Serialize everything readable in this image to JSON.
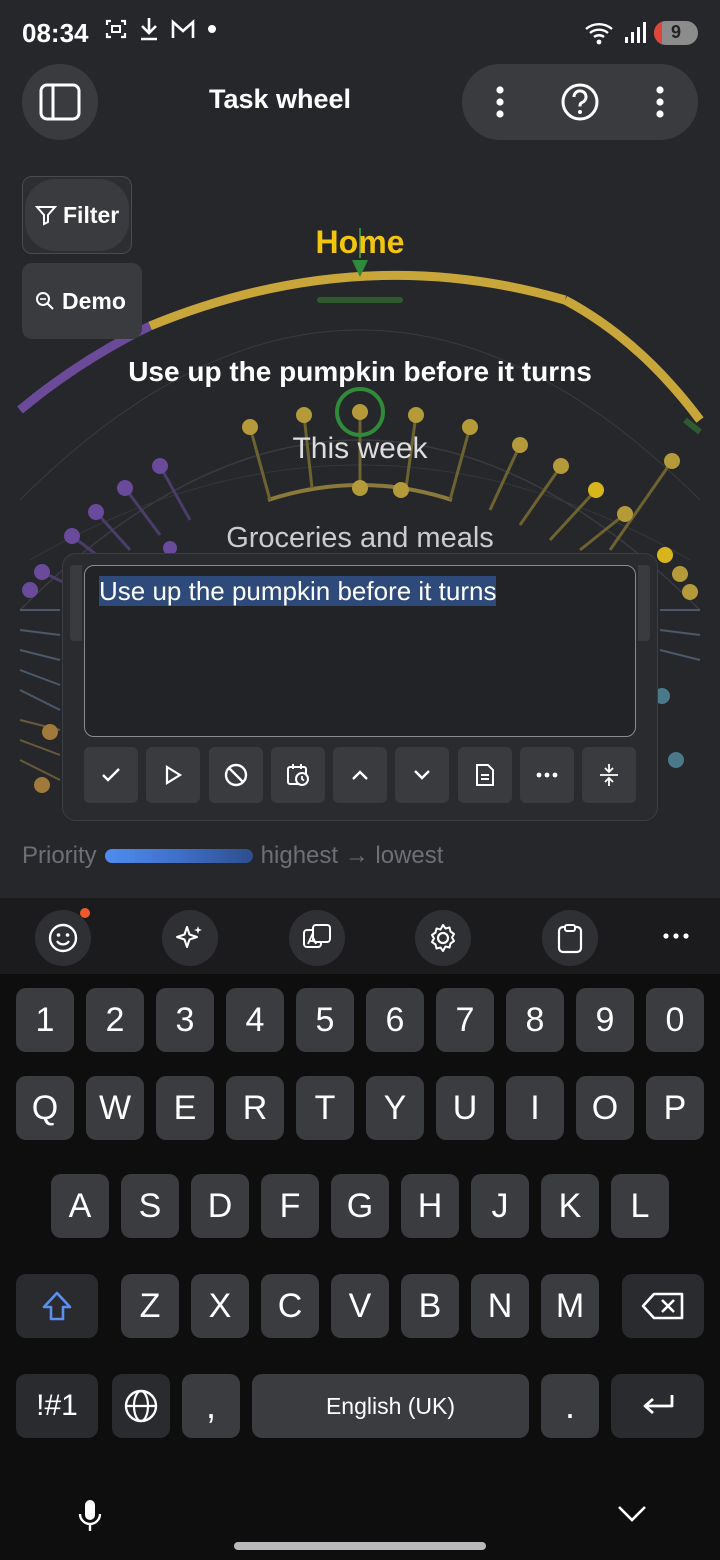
{
  "status": {
    "time": "08:34",
    "battery": "9",
    "left_icons": [
      "screenshot-icon",
      "download-icon",
      "gmail-icon",
      "dot-icon"
    ],
    "right_icons": [
      "wifi-icon",
      "signal-icon",
      "battery-icon"
    ]
  },
  "header": {
    "title": "Task wheel",
    "sidebar_icon": "sidebar-icon",
    "menu_icon": "more-vert-icon",
    "help_icon": "help-icon",
    "overflow_icon": "more-vert-icon"
  },
  "side": {
    "filter_label": "Filter",
    "demo_label": "Demo"
  },
  "wheel": {
    "home_label": "Home",
    "task_title": "Use up the pumpkin before it turns",
    "week_label": "This week",
    "group_label": "Groceries and meals",
    "colors": {
      "home": "#c9a63a",
      "purple": "#6b4a9a",
      "green": "#2f8a3a",
      "yellow": "#c9a63a"
    }
  },
  "editor": {
    "text": "Use up the pumpkin before it turns",
    "toolbar_icons": [
      "check-icon",
      "play-icon",
      "block-icon",
      "schedule-icon",
      "chevron-up-icon",
      "chevron-down-icon",
      "note-icon",
      "more-horiz-icon",
      "collapse-icon"
    ]
  },
  "priority": {
    "label": "Priority",
    "scale_text": "highest → lowest"
  },
  "keyboard": {
    "strip_icons": [
      "emoji-icon",
      "sparkle-icon",
      "translate-icon",
      "settings-icon",
      "clipboard-icon",
      "more-horiz-icon"
    ],
    "row_numbers": [
      "1",
      "2",
      "3",
      "4",
      "5",
      "6",
      "7",
      "8",
      "9",
      "0"
    ],
    "row_q": [
      "Q",
      "W",
      "E",
      "R",
      "T",
      "Y",
      "U",
      "I",
      "O",
      "P"
    ],
    "row_a": [
      "A",
      "S",
      "D",
      "F",
      "G",
      "H",
      "J",
      "K",
      "L"
    ],
    "row_z": [
      "Z",
      "X",
      "C",
      "V",
      "B",
      "N",
      "M"
    ],
    "symbols_key": "!#1",
    "comma_key": ",",
    "space_key": "English (UK)",
    "period_key": "."
  }
}
